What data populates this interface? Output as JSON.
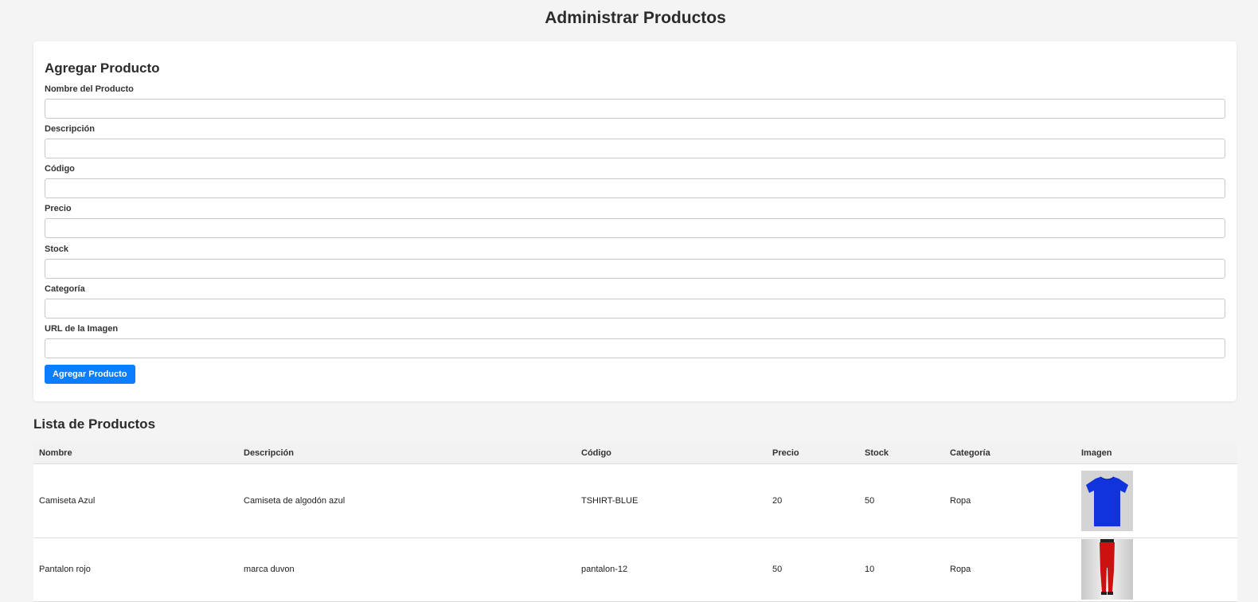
{
  "header": {
    "title": "Administrar Productos"
  },
  "form": {
    "title": "Agregar Producto",
    "fields": [
      {
        "label": "Nombre del Producto",
        "value": "",
        "placeholder": ""
      },
      {
        "label": "Descripción",
        "value": "",
        "placeholder": ""
      },
      {
        "label": "Código",
        "value": "",
        "placeholder": ""
      },
      {
        "label": "Precio",
        "value": "",
        "placeholder": ""
      },
      {
        "label": "Stock",
        "value": "",
        "placeholder": ""
      },
      {
        "label": "Categoría",
        "value": "",
        "placeholder": ""
      },
      {
        "label": "URL de la Imagen",
        "value": "",
        "placeholder": ""
      }
    ],
    "submit_label": "Agregar Producto",
    "submit_color": "#0b7dff"
  },
  "list": {
    "title": "Lista de Productos",
    "columns": [
      "Nombre",
      "Descripción",
      "Código",
      "Precio",
      "Stock",
      "Categoría",
      "Imagen"
    ],
    "rows": [
      {
        "nombre": "Camiseta Azul",
        "descripcion": "Camiseta de algodón azul",
        "codigo": "TSHIRT-BLUE",
        "precio": "20",
        "stock": "50",
        "categoria": "Ropa",
        "imagen": "blue-tshirt-image",
        "imagen_color": "#1133dd"
      },
      {
        "nombre": "Pantalon rojo",
        "descripcion": "marca duvon",
        "codigo": "pantalon-12",
        "precio": "50",
        "stock": "10",
        "categoria": "Ropa",
        "imagen": "red-pants-image",
        "imagen_color": "#cc1111"
      }
    ]
  }
}
